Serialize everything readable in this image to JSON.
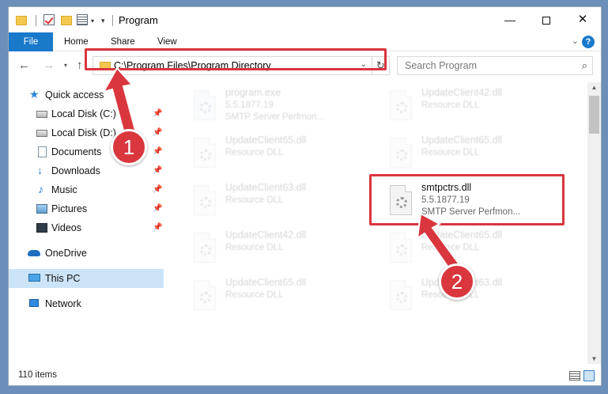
{
  "window": {
    "title": "Program",
    "controls": {
      "minimize": "—",
      "maximize": "",
      "close": "✕"
    }
  },
  "ribbon": {
    "tabs": [
      "File",
      "Home",
      "Share",
      "View"
    ],
    "help": "?"
  },
  "navigation": {
    "back": "←",
    "forward": "→",
    "up": "↑",
    "address": "C:\\Program Files\\Program Directory",
    "refresh": "↻",
    "search_placeholder": "Search Program",
    "search_icon": "⌕"
  },
  "sidebar": {
    "items": [
      {
        "label": "Quick access",
        "icon": "star-icon"
      },
      {
        "label": "Local Disk (C:)",
        "icon": "disk-icon",
        "pinned": true
      },
      {
        "label": "Local Disk (D:)",
        "icon": "disk-icon",
        "pinned": true
      },
      {
        "label": "Documents",
        "icon": "documents-icon",
        "pinned": true
      },
      {
        "label": "Downloads",
        "icon": "download-icon",
        "pinned": true
      },
      {
        "label": "Music",
        "icon": "music-icon",
        "pinned": true
      },
      {
        "label": "Pictures",
        "icon": "pictures-icon",
        "pinned": true
      },
      {
        "label": "Videos",
        "icon": "videos-icon",
        "pinned": true
      },
      {
        "label": "OneDrive",
        "icon": "cloud-icon"
      },
      {
        "label": "This PC",
        "icon": "computer-icon",
        "selected": true
      },
      {
        "label": "Network",
        "icon": "network-icon"
      }
    ]
  },
  "files": [
    {
      "name": "program.exe",
      "version": "5.5.1877.19",
      "desc": "SMTP Server Perfmon...",
      "type": "exe",
      "faded": true
    },
    {
      "name": "UpdateClient42.dll",
      "desc": "Resource DLL",
      "type": "dll",
      "faded": true
    },
    {
      "name": "UpdateClient65.dll",
      "desc": "Resource DLL",
      "type": "dll",
      "faded": true
    },
    {
      "name": "UpdateClient65.dll",
      "desc": "Resource DLL",
      "type": "dll",
      "faded": true
    },
    {
      "name": "UpdateClient63.dll",
      "desc": "Resource DLL",
      "type": "dll",
      "faded": true
    },
    {
      "name": "smtpctrs.dll",
      "version": "5.5.1877.19",
      "desc": "SMTP Server Perfmon...",
      "type": "dll",
      "faded": false
    },
    {
      "name": "UpdateClient42.dll",
      "desc": "Resource DLL",
      "type": "dll",
      "faded": true
    },
    {
      "name": "UpdateClient65.dll",
      "desc": "Resource DLL",
      "type": "dll",
      "faded": true
    },
    {
      "name": "UpdateClient65.dll",
      "desc": "Resource DLL",
      "type": "dll",
      "faded": true
    },
    {
      "name": "UpdateClient63.dll",
      "desc": "Resource DLL",
      "type": "dll",
      "faded": true
    }
  ],
  "status": {
    "items_count": "110 items"
  },
  "annotations": {
    "step1": "1",
    "step2": "2",
    "accent_color": "#d9363e"
  }
}
